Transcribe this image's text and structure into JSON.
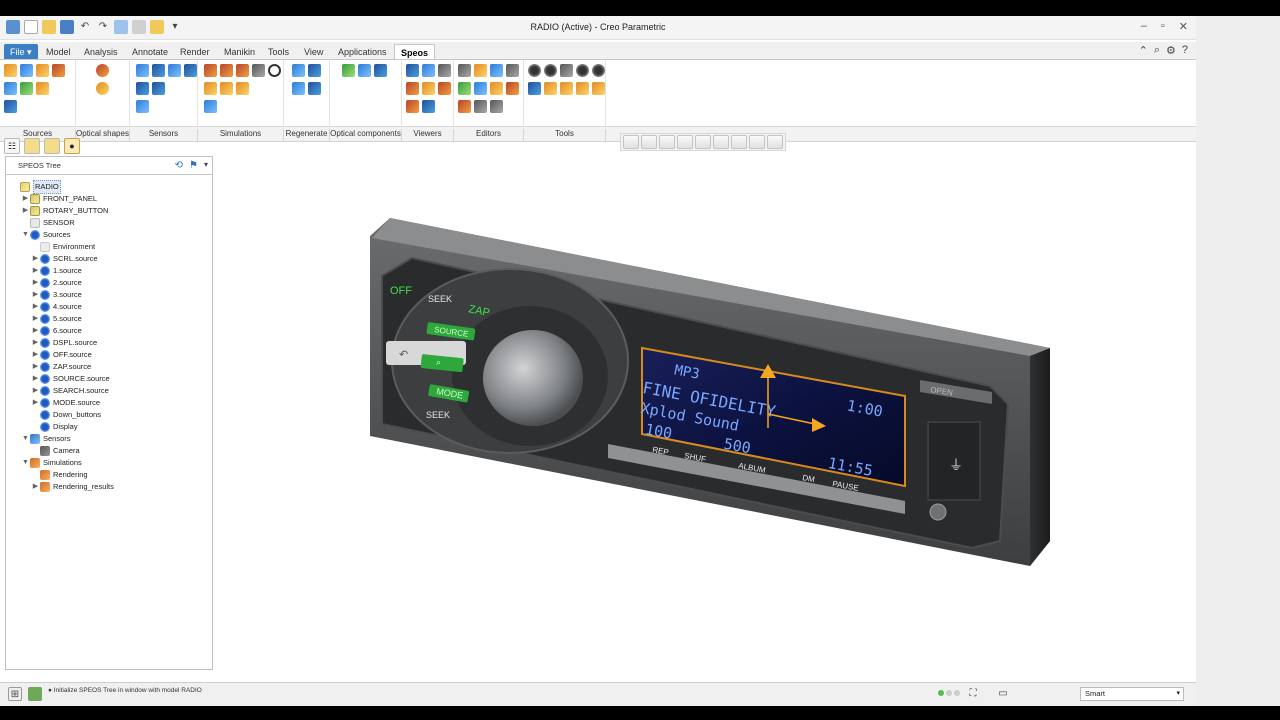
{
  "window": {
    "title": "RADIO (Active) - Creo Parametric"
  },
  "menu": {
    "tabs": [
      "File",
      "Model",
      "Analysis",
      "Annotate",
      "Render",
      "Manikin",
      "Tools",
      "View",
      "Applications",
      "Speos"
    ],
    "file_label": "File",
    "active_tab": "Speos"
  },
  "ribbon": {
    "groups": [
      "Sources",
      "Optical shapes",
      "Sensors",
      "Simulations",
      "Regenerate",
      "Optical components",
      "Viewers",
      "Editors",
      "Tools"
    ]
  },
  "tree": {
    "header": "SPEOS Tree",
    "items": [
      {
        "label": "RADIO",
        "level": 0,
        "icon": "asm",
        "expander": ""
      },
      {
        "label": "FRONT_PANEL",
        "level": 1,
        "icon": "part",
        "expander": "▶"
      },
      {
        "label": "ROTARY_BUTTON",
        "level": 1,
        "icon": "part",
        "expander": "▶"
      },
      {
        "label": "SENSOR",
        "level": 1,
        "icon": "plain",
        "expander": ""
      },
      {
        "label": "Sources",
        "level": 1,
        "icon": "src",
        "expander": "▼"
      },
      {
        "label": "Environment",
        "level": 2,
        "icon": "env",
        "expander": ""
      },
      {
        "label": "SCRL.source",
        "level": 2,
        "icon": "src",
        "expander": "▶"
      },
      {
        "label": "1.source",
        "level": 2,
        "icon": "src",
        "expander": "▶"
      },
      {
        "label": "2.source",
        "level": 2,
        "icon": "src",
        "expander": "▶"
      },
      {
        "label": "3.source",
        "level": 2,
        "icon": "src",
        "expander": "▶"
      },
      {
        "label": "4.source",
        "level": 2,
        "icon": "src",
        "expander": "▶"
      },
      {
        "label": "5.source",
        "level": 2,
        "icon": "src",
        "expander": "▶"
      },
      {
        "label": "6.source",
        "level": 2,
        "icon": "src",
        "expander": "▶"
      },
      {
        "label": "DSPL.source",
        "level": 2,
        "icon": "src",
        "expander": "▶"
      },
      {
        "label": "OFF.source",
        "level": 2,
        "icon": "src",
        "expander": "▶"
      },
      {
        "label": "ZAP.source",
        "level": 2,
        "icon": "src",
        "expander": "▶"
      },
      {
        "label": "SOURCE.source",
        "level": 2,
        "icon": "src",
        "expander": "▶"
      },
      {
        "label": "SEARCH.source",
        "level": 2,
        "icon": "src",
        "expander": "▶"
      },
      {
        "label": "MODE.source",
        "level": 2,
        "icon": "src",
        "expander": "▶"
      },
      {
        "label": "Down_buttons",
        "level": 2,
        "icon": "src",
        "expander": ""
      },
      {
        "label": "Display",
        "level": 2,
        "icon": "src",
        "expander": ""
      },
      {
        "label": "Sensors",
        "level": 1,
        "icon": "sens",
        "expander": "▼"
      },
      {
        "label": "Camera",
        "level": 2,
        "icon": "cam",
        "expander": ""
      },
      {
        "label": "Simulations",
        "level": 1,
        "icon": "sim",
        "expander": "▼"
      },
      {
        "label": "Rendering",
        "level": 2,
        "icon": "sim",
        "expander": ""
      },
      {
        "label": "Rendering_results",
        "level": 2,
        "icon": "sim",
        "expander": "▶"
      }
    ]
  },
  "model": {
    "buttons": {
      "off": "OFF",
      "seek_top": "SEEK",
      "zap": "ZAP",
      "source": "SOURCE",
      "mode": "MODE",
      "seek_bottom": "SEEK",
      "open": "OPEN"
    },
    "display": {
      "line1": "MP3",
      "line2": "FINE OFIDELITY",
      "line3": "Xplod Sound",
      "line4a": "100",
      "line4b": "500",
      "time1": "1:00",
      "time2": "11:55"
    },
    "preset_labels": [
      "REP",
      "SHUF",
      "ALBUM",
      "DM",
      "PAUSE"
    ]
  },
  "status": {
    "message": "Initialize SPEOS Tree in window with model RADIO",
    "filter_value": "Smart"
  }
}
